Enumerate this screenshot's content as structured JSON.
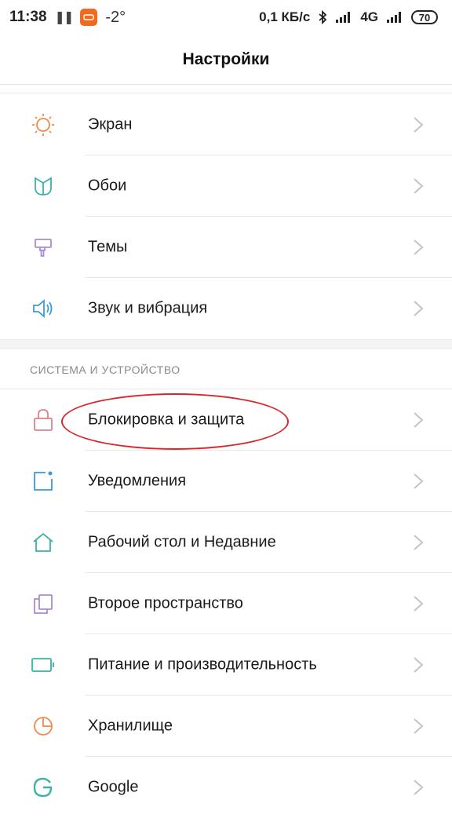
{
  "status_bar": {
    "time": "11:38",
    "temperature": "-2°",
    "net_speed": "0,1 КБ/с",
    "network_type": "4G",
    "battery": "70"
  },
  "header": {
    "title": "Настройки"
  },
  "group1": {
    "items": [
      {
        "label": "Экран",
        "icon": "sun-icon"
      },
      {
        "label": "Обои",
        "icon": "tulip-icon"
      },
      {
        "label": "Темы",
        "icon": "paint-roller-icon"
      },
      {
        "label": "Звук и вибрация",
        "icon": "speaker-icon"
      }
    ]
  },
  "group2": {
    "title": "СИСТЕМА И УСТРОЙСТВО",
    "items": [
      {
        "label": "Блокировка и защита",
        "icon": "lock-icon"
      },
      {
        "label": "Уведомления",
        "icon": "notification-icon"
      },
      {
        "label": "Рабочий стол и Недавние",
        "icon": "home-icon"
      },
      {
        "label": "Второе пространство",
        "icon": "second-space-icon"
      },
      {
        "label": "Питание и производительность",
        "icon": "battery-icon"
      },
      {
        "label": "Хранилище",
        "icon": "storage-pie-icon"
      },
      {
        "label": "Google",
        "icon": "google-icon"
      }
    ]
  },
  "colors": {
    "accent_orange": "#f08a4b",
    "accent_teal": "#3bb3a6",
    "accent_purple": "#a98bd6",
    "accent_blue": "#3a9ad9",
    "accent_red": "#d8848a",
    "annotation_red": "#d8262d"
  }
}
